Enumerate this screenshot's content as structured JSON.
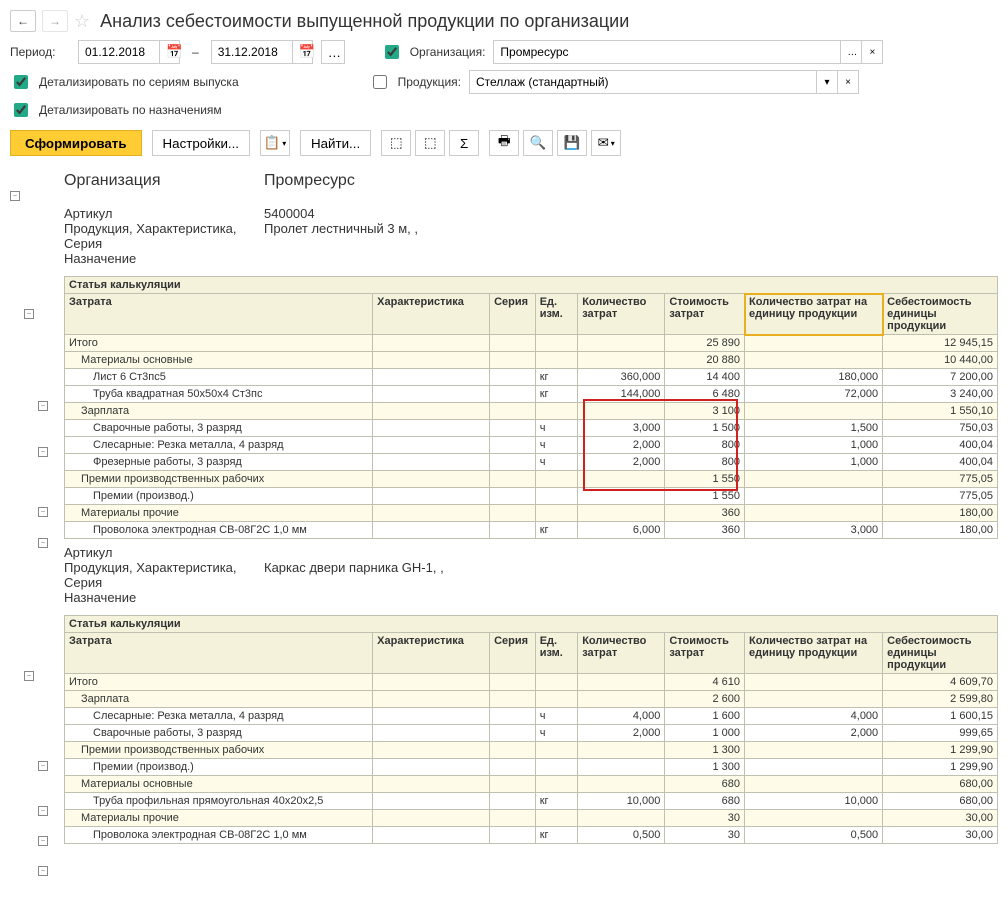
{
  "header": {
    "title": "Анализ себестоимости выпущенной продукции по организации"
  },
  "filters": {
    "period_label": "Период:",
    "date_from": "01.12.2018",
    "date_to": "31.12.2018",
    "org_checkbox_label": "Организация:",
    "org_value": "Промресурс",
    "prod_checkbox_label": "Продукция:",
    "prod_value": "Стеллаж (стандартный)",
    "detail_series_label": "Детализировать по сериям выпуска",
    "detail_purpose_label": "Детализировать по назначениям"
  },
  "toolbar": {
    "form_btn": "Сформировать",
    "settings_btn": "Настройки...",
    "find_btn": "Найти..."
  },
  "report": {
    "org_label": "Организация",
    "org_value": "Промресурс",
    "article_label": "Артикул",
    "product_label": "Продукция, Характеристика, Серия",
    "purpose_label": "Назначение",
    "section_calc": "Статья калькуляции",
    "cols": {
      "zatrata": "Затрата",
      "char": "Характеристика",
      "series": "Серия",
      "unit": "Ед. изм.",
      "qty": "Количество затрат",
      "cost": "Стоимость затрат",
      "qty_unit": "Количество затрат на единицу продукции",
      "cost_unit": "Себестоимость единицы продукции"
    },
    "products": [
      {
        "article": "5400004",
        "name": "Пролет лестничный 3 м, ,",
        "totals": {
          "label": "Итого",
          "cost": "25 890",
          "cost_unit": "12 945,15"
        },
        "groups": [
          {
            "label": "Материалы основные",
            "cost": "20 880",
            "cost_unit": "10 440,00",
            "rows": [
              {
                "name": "Лист 6 Ст3пс5",
                "unit": "кг",
                "qty": "360,000",
                "cost": "14 400",
                "qty_unit": "180,000",
                "cost_unit": "7 200,00"
              },
              {
                "name": "Труба квадратная 50х50х4 Ст3пс",
                "unit": "кг",
                "qty": "144,000",
                "cost": "6 480",
                "qty_unit": "72,000",
                "cost_unit": "3 240,00"
              }
            ]
          },
          {
            "label": "Зарплата",
            "cost": "3 100",
            "cost_unit": "1 550,10",
            "rows": [
              {
                "name": "Сварочные работы, 3 разряд",
                "unit": "ч",
                "qty": "3,000",
                "cost": "1 500",
                "qty_unit": "1,500",
                "cost_unit": "750,03"
              },
              {
                "name": "Слесарные: Резка металла, 4 разряд",
                "unit": "ч",
                "qty": "2,000",
                "cost": "800",
                "qty_unit": "1,000",
                "cost_unit": "400,04"
              },
              {
                "name": "Фрезерные работы, 3 разряд",
                "unit": "ч",
                "qty": "2,000",
                "cost": "800",
                "qty_unit": "1,000",
                "cost_unit": "400,04"
              }
            ]
          },
          {
            "label": "Премии производственных рабочих",
            "cost": "1 550",
            "cost_unit": "775,05",
            "rows": [
              {
                "name": "Премии (производ.)",
                "unit": "",
                "qty": "",
                "cost": "1 550",
                "qty_unit": "",
                "cost_unit": "775,05"
              }
            ]
          },
          {
            "label": "Материалы прочие",
            "cost": "360",
            "cost_unit": "180,00",
            "rows": [
              {
                "name": "Проволока электродная СВ-08Г2С 1,0 мм",
                "unit": "кг",
                "qty": "6,000",
                "cost": "360",
                "qty_unit": "3,000",
                "cost_unit": "180,00"
              }
            ]
          }
        ]
      },
      {
        "article": "",
        "name": "Каркас двери парника GH-1, ,",
        "totals": {
          "label": "Итого",
          "cost": "4 610",
          "cost_unit": "4 609,70"
        },
        "groups": [
          {
            "label": "Зарплата",
            "cost": "2 600",
            "cost_unit": "2 599,80",
            "rows": [
              {
                "name": "Слесарные: Резка металла, 4 разряд",
                "unit": "ч",
                "qty": "4,000",
                "cost": "1 600",
                "qty_unit": "4,000",
                "cost_unit": "1 600,15"
              },
              {
                "name": "Сварочные работы, 3 разряд",
                "unit": "ч",
                "qty": "2,000",
                "cost": "1 000",
                "qty_unit": "2,000",
                "cost_unit": "999,65"
              }
            ]
          },
          {
            "label": "Премии производственных рабочих",
            "cost": "1 300",
            "cost_unit": "1 299,90",
            "rows": [
              {
                "name": "Премии (производ.)",
                "unit": "",
                "qty": "",
                "cost": "1 300",
                "qty_unit": "",
                "cost_unit": "1 299,90"
              }
            ]
          },
          {
            "label": "Материалы основные",
            "cost": "680",
            "cost_unit": "680,00",
            "rows": [
              {
                "name": "Труба профильная прямоугольная 40х20х2,5",
                "unit": "кг",
                "qty": "10,000",
                "cost": "680",
                "qty_unit": "10,000",
                "cost_unit": "680,00"
              }
            ]
          },
          {
            "label": "Материалы прочие",
            "cost": "30",
            "cost_unit": "30,00",
            "rows": [
              {
                "name": "Проволока электродная СВ-08Г2С 1,0 мм",
                "unit": "кг",
                "qty": "0,500",
                "cost": "30",
                "qty_unit": "0,500",
                "cost_unit": "30,00"
              }
            ]
          }
        ]
      }
    ]
  }
}
